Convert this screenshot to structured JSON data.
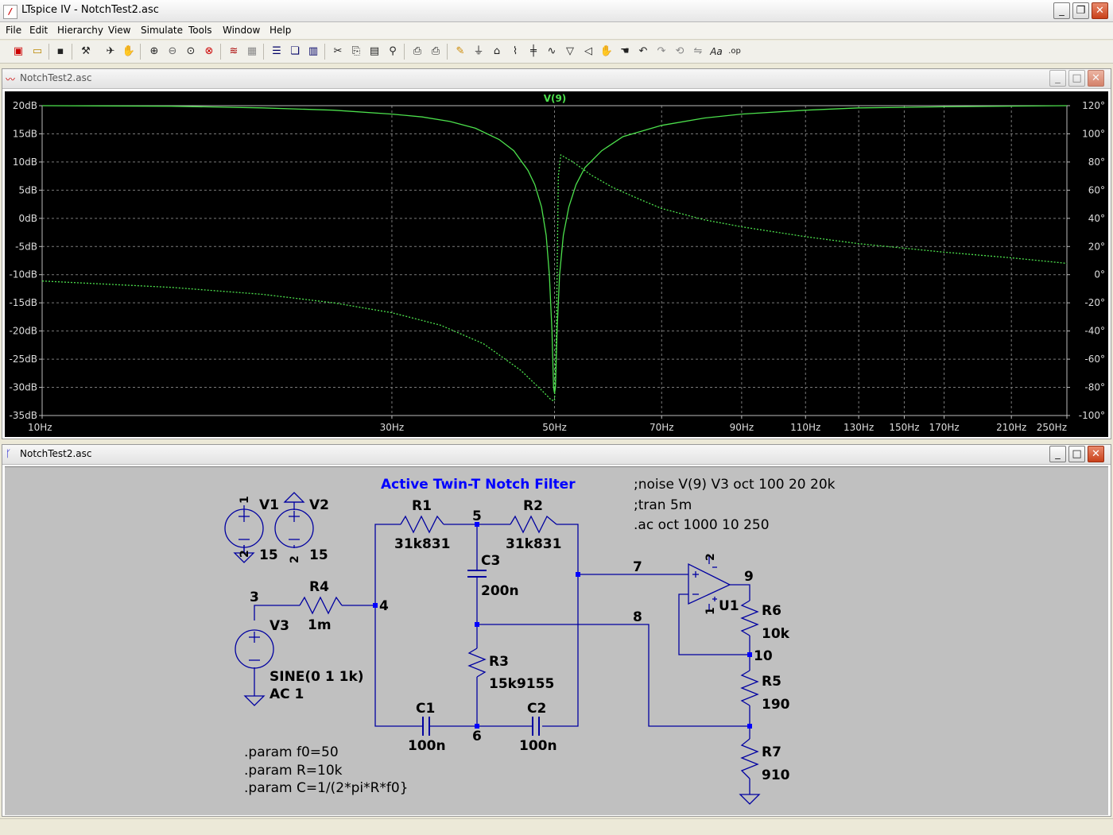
{
  "window": {
    "title": "LTspice IV - NotchTest2.asc",
    "minimize_glyph": "_",
    "maximize_glyph": "❐",
    "close_glyph": "✕"
  },
  "menu": [
    "File",
    "Edit",
    "Hierarchy",
    "View",
    "Simulate",
    "Tools",
    "Window",
    "Help"
  ],
  "toolbar_icons": [
    "new-schematic-icon",
    "open-icon",
    "save-icon",
    "control-panel-icon",
    "run-icon",
    "halt-icon",
    "zoom-in-icon",
    "zoom-out-icon",
    "zoom-fit-icon",
    "zoom-cancel-icon",
    "autorange-icon",
    "grid-icon",
    "tile-horizontal-icon",
    "cascade-icon",
    "tile-vertical-icon",
    "cut-icon",
    "copy-icon",
    "paste-icon",
    "find-icon",
    "print-setup-icon",
    "print-icon",
    "draw-wire-icon",
    "ground-icon",
    "label-net-icon",
    "resistor-icon",
    "capacitor-icon",
    "inductor-icon",
    "diode-icon",
    "component-icon",
    "move-icon",
    "drag-icon",
    "undo-icon",
    "redo-icon",
    "rotate-icon",
    "mirror-icon",
    "text-icon",
    "spice-directive-icon"
  ],
  "waveform_window": {
    "title": "NotchTest2.asc",
    "trace_label": "V(9)",
    "trace_color": "#4ce04c",
    "background": "#000000",
    "grid_color": "#7a7a7a"
  },
  "chart_data": {
    "type": "line",
    "title": "V(9)",
    "x_scale": "log",
    "xlim": [
      10,
      250
    ],
    "x_ticks": [
      10,
      30,
      50,
      70,
      90,
      110,
      130,
      150,
      170,
      210,
      250
    ],
    "x_tick_labels": [
      "10Hz",
      "30Hz",
      "50Hz",
      "70Hz",
      "90Hz",
      "110Hz",
      "130Hz",
      "150Hz",
      "170Hz",
      "210Hz",
      "250Hz"
    ],
    "ylim_left": [
      -35,
      20
    ],
    "y_ticks_left": [
      20,
      15,
      10,
      5,
      0,
      -5,
      -10,
      -15,
      -20,
      -25,
      -30,
      -35
    ],
    "y_tick_labels_left": [
      "20dB",
      "15dB",
      "10dB",
      "5dB",
      "0dB",
      "-5dB",
      "-10dB",
      "-15dB",
      "-20dB",
      "-25dB",
      "-30dB",
      "-35dB"
    ],
    "ylim_right": [
      -100,
      120
    ],
    "y_ticks_right": [
      120,
      100,
      80,
      60,
      40,
      20,
      0,
      -20,
      -40,
      -60,
      -80,
      -100
    ],
    "y_tick_labels_right": [
      "120°",
      "100°",
      "80°",
      "60°",
      "40°",
      "20°",
      "0°",
      "-20°",
      "-40°",
      "-60°",
      "-80°",
      "-100°"
    ],
    "grid": true,
    "series": [
      {
        "name": "V(9)",
        "axis": "left",
        "style": "solid",
        "points": [
          [
            10,
            20.0
          ],
          [
            15,
            19.9
          ],
          [
            20,
            19.6
          ],
          [
            25,
            19.2
          ],
          [
            30,
            18.5
          ],
          [
            33,
            18.0
          ],
          [
            36,
            17.2
          ],
          [
            39,
            16.0
          ],
          [
            42,
            14.0
          ],
          [
            44,
            12.0
          ],
          [
            46,
            8.5
          ],
          [
            47,
            6.0
          ],
          [
            48,
            2.0
          ],
          [
            48.7,
            -3.0
          ],
          [
            49.2,
            -10.0
          ],
          [
            49.6,
            -20.0
          ],
          [
            49.85,
            -30.0
          ],
          [
            50,
            -31.0
          ],
          [
            50.15,
            -30.0
          ],
          [
            50.4,
            -20.0
          ],
          [
            50.8,
            -10.0
          ],
          [
            51.4,
            -3.0
          ],
          [
            52.3,
            2.0
          ],
          [
            53.5,
            6.0
          ],
          [
            55,
            9.0
          ],
          [
            58,
            12.0
          ],
          [
            62,
            14.5
          ],
          [
            70,
            16.5
          ],
          [
            80,
            17.8
          ],
          [
            90,
            18.5
          ],
          [
            110,
            19.2
          ],
          [
            130,
            19.6
          ],
          [
            170,
            19.8
          ],
          [
            250,
            20.0
          ]
        ]
      },
      {
        "name": "V(9) phase",
        "axis": "right",
        "style": "dashed",
        "points": [
          [
            10,
            -4.5
          ],
          [
            15,
            -9.0
          ],
          [
            20,
            -14.0
          ],
          [
            25,
            -20.0
          ],
          [
            30,
            -27.0
          ],
          [
            35,
            -36.0
          ],
          [
            40,
            -49.0
          ],
          [
            45,
            -68.0
          ],
          [
            48,
            -82.0
          ],
          [
            49.5,
            -89.0
          ],
          [
            50,
            -89.5
          ],
          [
            50.3,
            -40.0
          ],
          [
            50.6,
            70.0
          ],
          [
            51,
            85.0
          ],
          [
            53,
            80.0
          ],
          [
            56,
            71.0
          ],
          [
            60,
            62.0
          ],
          [
            65,
            54.0
          ],
          [
            70,
            47.0
          ],
          [
            80,
            39.0
          ],
          [
            90,
            34.0
          ],
          [
            110,
            27.0
          ],
          [
            130,
            22.0
          ],
          [
            170,
            16.0
          ],
          [
            210,
            12.0
          ],
          [
            250,
            8.0
          ]
        ]
      }
    ]
  },
  "schematic_window": {
    "title": "NotchTest2.asc",
    "wire_color": "#0000a0",
    "junction_color": "#0000ff",
    "label_color": "#000000",
    "title_color": "#0000ff",
    "heading": "Active Twin-T Notch Filter",
    "directives": [
      ";noise V(9) V3 oct 100 20 20k",
      ";tran 5m",
      ".ac oct 1000 10 250"
    ],
    "params": [
      ".param f0=50",
      ".param R=10k",
      ".param C=1/(2*pi*R*f0}"
    ],
    "components": {
      "V1": {
        "ref": "V1",
        "value": "15",
        "pin_top": "1",
        "pin_bottom": "2"
      },
      "V2": {
        "ref": "V2",
        "value": "15",
        "pin_bottom": "2"
      },
      "V3": {
        "ref": "V3",
        "value1": "SINE(0 1 1k)",
        "value2": "AC 1"
      },
      "R1": {
        "ref": "R1",
        "value": "31k831"
      },
      "R2": {
        "ref": "R2",
        "value": "31k831"
      },
      "R3": {
        "ref": "R3",
        "value": "15k9155"
      },
      "R4": {
        "ref": "R4",
        "value": "1m"
      },
      "R5": {
        "ref": "R5",
        "value": "190"
      },
      "R6": {
        "ref": "R6",
        "value": "10k"
      },
      "R7": {
        "ref": "R7",
        "value": "910"
      },
      "C1": {
        "ref": "C1",
        "value": "100n"
      },
      "C2": {
        "ref": "C2",
        "value": "100n"
      },
      "C3": {
        "ref": "C3",
        "value": "200n"
      },
      "U1": {
        "ref": "U1",
        "pin_top": "2",
        "pin_bottom": "1",
        "plus": "+",
        "minus": "-"
      }
    },
    "nets": {
      "n3": "3",
      "n4": "4",
      "n5": "5",
      "n6": "6",
      "n7": "7",
      "n8": "8",
      "n9": "9",
      "n10": "10"
    }
  }
}
